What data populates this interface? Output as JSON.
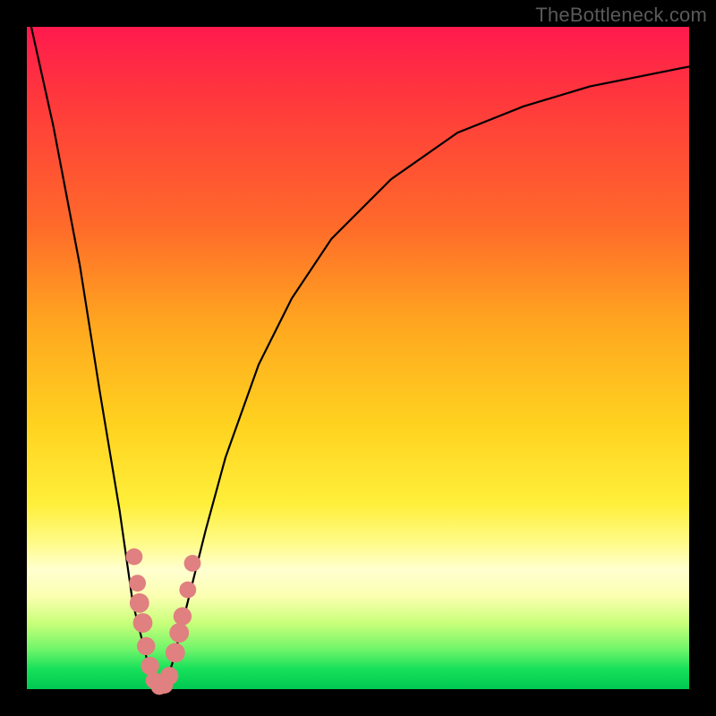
{
  "watermark": "TheBottleneck.com",
  "chart_data": {
    "type": "line",
    "title": "",
    "xlabel": "",
    "ylabel": "",
    "xlim": [
      0,
      100
    ],
    "ylim": [
      0,
      100
    ],
    "series": [
      {
        "name": "bottleneck-curve",
        "x": [
          0,
          4,
          8,
          11,
          14,
          16,
          18,
          19,
          20,
          21,
          22,
          24,
          27,
          30,
          35,
          40,
          46,
          55,
          65,
          75,
          85,
          95,
          100
        ],
        "values": [
          103,
          85,
          64,
          45,
          27,
          13,
          5,
          1,
          0,
          1,
          4,
          12,
          24,
          35,
          49,
          59,
          68,
          77,
          84,
          88,
          91,
          93,
          94
        ]
      }
    ],
    "markers": {
      "name": "highlight-dots",
      "color": "#e08080",
      "points": [
        {
          "x": 16.2,
          "y": 20.0,
          "r": 1.2
        },
        {
          "x": 16.7,
          "y": 16.0,
          "r": 1.2
        },
        {
          "x": 17.0,
          "y": 13.0,
          "r": 1.6
        },
        {
          "x": 17.5,
          "y": 10.0,
          "r": 1.6
        },
        {
          "x": 18.0,
          "y": 6.5,
          "r": 1.4
        },
        {
          "x": 18.6,
          "y": 3.5,
          "r": 1.4
        },
        {
          "x": 19.2,
          "y": 1.3,
          "r": 1.2
        },
        {
          "x": 20.0,
          "y": 0.4,
          "r": 1.2
        },
        {
          "x": 20.8,
          "y": 0.6,
          "r": 1.2
        },
        {
          "x": 21.5,
          "y": 2.0,
          "r": 1.4
        },
        {
          "x": 22.4,
          "y": 5.5,
          "r": 1.6
        },
        {
          "x": 23.0,
          "y": 8.5,
          "r": 1.6
        },
        {
          "x": 23.5,
          "y": 11.0,
          "r": 1.4
        },
        {
          "x": 24.3,
          "y": 15.0,
          "r": 1.2
        },
        {
          "x": 25.0,
          "y": 19.0,
          "r": 1.2
        }
      ]
    }
  }
}
